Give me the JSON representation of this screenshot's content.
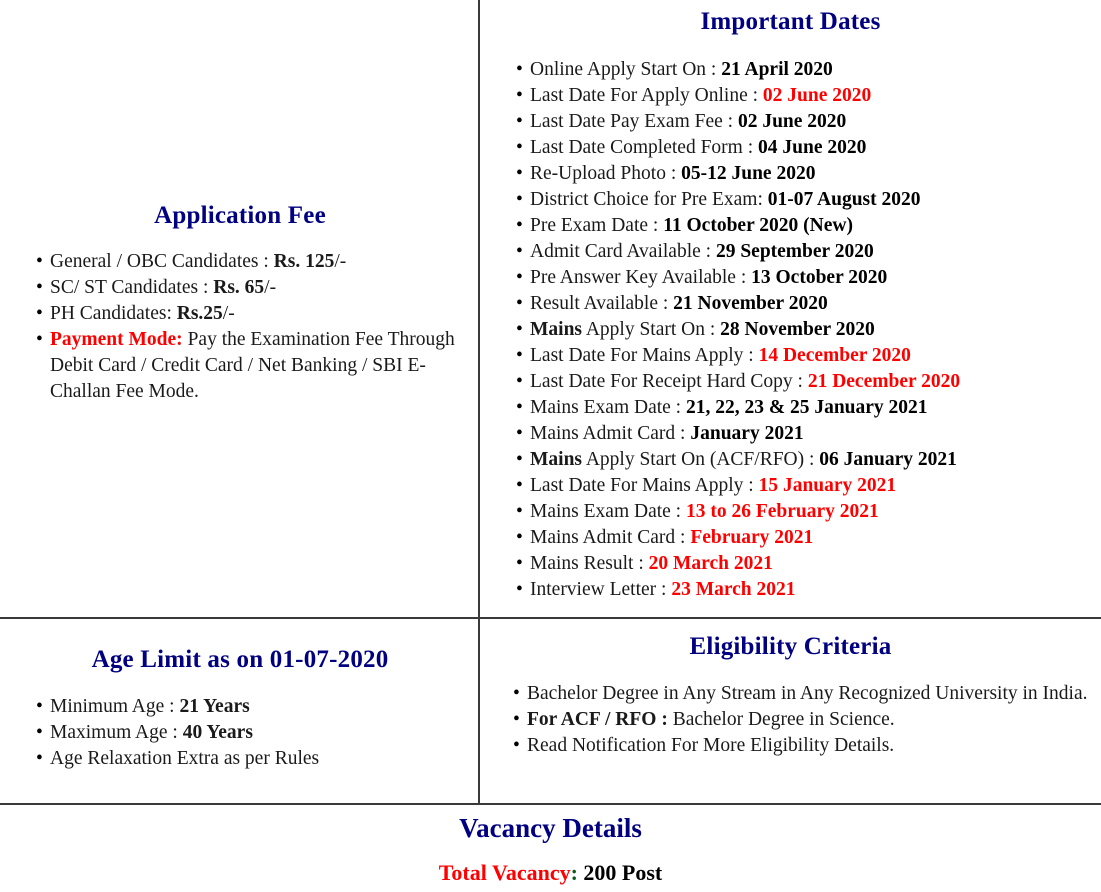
{
  "application_fee": {
    "title": "Application Fee",
    "items": [
      {
        "label": "General / OBC Candidates : ",
        "value": "Rs. 125",
        "suffix": "/-",
        "value_style": "bold"
      },
      {
        "label": "SC/ ST Candidates : ",
        "value": "Rs. 65",
        "suffix": "/-",
        "value_style": "bold"
      },
      {
        "label": "PH Candidates: ",
        "value": "Rs.25",
        "suffix": "/-",
        "value_style": "bold"
      }
    ],
    "payment_mode_label": "Payment Mode:",
    "payment_mode_text": " Pay the Examination Fee Through Debit Card / Credit Card / Net Banking  / SBI E-Challan Fee Mode."
  },
  "important_dates": {
    "title": "Important Dates",
    "items": [
      {
        "label": "Online Apply Start On : ",
        "value": "21 April 2020",
        "color": "black"
      },
      {
        "label": "Last Date For Apply Online : ",
        "value": "02 June 2020",
        "color": "red"
      },
      {
        "label": "Last Date Pay Exam Fee : ",
        "value": "02 June 2020",
        "color": "black"
      },
      {
        "label": "Last Date Completed Form : ",
        "value": "04 June 2020",
        "color": "black"
      },
      {
        "label": "Re-Upload Photo : ",
        "value": "05-12 June 2020",
        "color": "black"
      },
      {
        "label": "District Choice for Pre Exam: ",
        "value": "01-07 August 2020",
        "color": "black"
      },
      {
        "label": "Pre Exam Date : ",
        "value": "11 October 2020 (New)",
        "color": "black"
      },
      {
        "label": "Admit Card Available : ",
        "value": "29 September 2020",
        "color": "black"
      },
      {
        "label": "Pre Answer Key Available : ",
        "value": "13 October 2020",
        "color": "black"
      },
      {
        "label": "Result Available : ",
        "value": "21 November 2020",
        "color": "black"
      },
      {
        "label_bold": "Mains",
        "label": " Apply Start On : ",
        "value": "28 November 2020",
        "color": "black"
      },
      {
        "label": "Last Date For Mains Apply : ",
        "value": "14 December 2020",
        "color": "red"
      },
      {
        "label": "Last Date For Receipt Hard Copy : ",
        "value": "21 December 2020",
        "color": "red"
      },
      {
        "label": "Mains Exam Date : ",
        "value": "21, 22, 23 & 25 January 2021",
        "color": "black"
      },
      {
        "label": "Mains Admit Card : ",
        "value": "January 2021",
        "color": "black"
      },
      {
        "label_bold": "Mains",
        "label": " Apply Start On (ACF/RFO) : ",
        "value": "06 January 2021",
        "color": "black"
      },
      {
        "label": "Last Date For Mains Apply : ",
        "value": "15 January 2021",
        "color": "red"
      },
      {
        "label": "Mains Exam Date : ",
        "value": "13 to 26 February 2021",
        "color": "red"
      },
      {
        "label": "Mains Admit Card : ",
        "value": "February 2021",
        "color": "red"
      },
      {
        "label": "Mains Result : ",
        "value": "20 March 2021",
        "color": "red"
      },
      {
        "label": "Interview Letter : ",
        "value": "23 March 2021",
        "color": "red"
      }
    ]
  },
  "age_limit": {
    "title": "Age Limit as on 01-07-2020",
    "items": [
      {
        "label": "Minimum Age : ",
        "value": "21 Years"
      },
      {
        "label": "Maximum Age : ",
        "value": "40 Years"
      },
      {
        "label": "Age Relaxation Extra as per Rules",
        "value": ""
      }
    ]
  },
  "eligibility": {
    "title": "Eligibility Criteria",
    "items": [
      {
        "label": "Bachelor Degree in Any Stream in Any Recognized University in India.",
        "value": ""
      },
      {
        "label_bold": "For ACF / RFO :",
        "label": " Bachelor Degree in Science.",
        "value": ""
      },
      {
        "label": "Read Notification For More Eligibility Details.",
        "value": ""
      }
    ]
  },
  "vacancy": {
    "title": "Vacancy Details",
    "total_label": "Total Vacancy",
    "total_colon": ":",
    "total_value": " 200 Post"
  },
  "colors": {
    "heading": "#000080",
    "highlight": "#ff0000",
    "text": "#000000",
    "rule": "#3a3a3a"
  }
}
